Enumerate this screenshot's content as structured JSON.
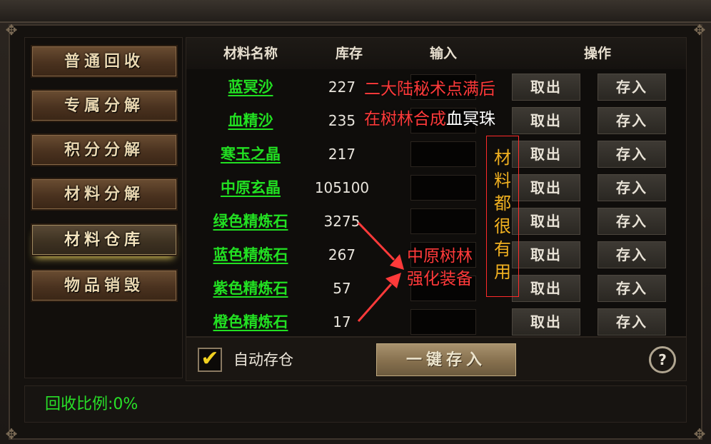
{
  "sidebar": {
    "items": [
      {
        "label": "普通回收"
      },
      {
        "label": "专属分解"
      },
      {
        "label": "积分分解"
      },
      {
        "label": "材料分解"
      },
      {
        "label": "材料仓库"
      },
      {
        "label": "物品销毁"
      }
    ],
    "active_index": 4
  },
  "table": {
    "headers": {
      "name": "材料名称",
      "stock": "库存",
      "input": "输入",
      "action": "操作"
    },
    "rows": [
      {
        "name": "蓝冥沙",
        "stock": "227",
        "take": "取出",
        "store": "存入"
      },
      {
        "name": "血精沙",
        "stock": "235",
        "take": "取出",
        "store": "存入"
      },
      {
        "name": "寒玉之晶",
        "stock": "217",
        "take": "取出",
        "store": "存入"
      },
      {
        "name": "中原玄晶",
        "stock": "105100",
        "take": "取出",
        "store": "存入"
      },
      {
        "name": "绿色精炼石",
        "stock": "3275",
        "take": "取出",
        "store": "存入"
      },
      {
        "name": "蓝色精炼石",
        "stock": "267",
        "take": "取出",
        "store": "存入"
      },
      {
        "name": "紫色精炼石",
        "stock": "57",
        "take": "取出",
        "store": "存入"
      },
      {
        "name": "橙色精炼石",
        "stock": "17",
        "take": "取出",
        "store": "存入"
      }
    ]
  },
  "bottom": {
    "auto_store_label": "自动存仓",
    "auto_store_checked": true,
    "one_key_label": "一键存入",
    "help_label": "?"
  },
  "status": {
    "recycle_ratio": "回收比例:0%"
  },
  "annotations": {
    "top_line1": "二大陆秘术点满后",
    "top_line2_red": "在树林合成",
    "top_line2_white": "血冥珠",
    "vertical_box": "材料都很有用",
    "mid_line1": "中原树林",
    "mid_line2": "强化装备"
  },
  "colors": {
    "material_green": "#22e022",
    "annotation_red": "#ff3a3a",
    "annotation_orange": "#f0b020",
    "status_green": "#28e028"
  }
}
